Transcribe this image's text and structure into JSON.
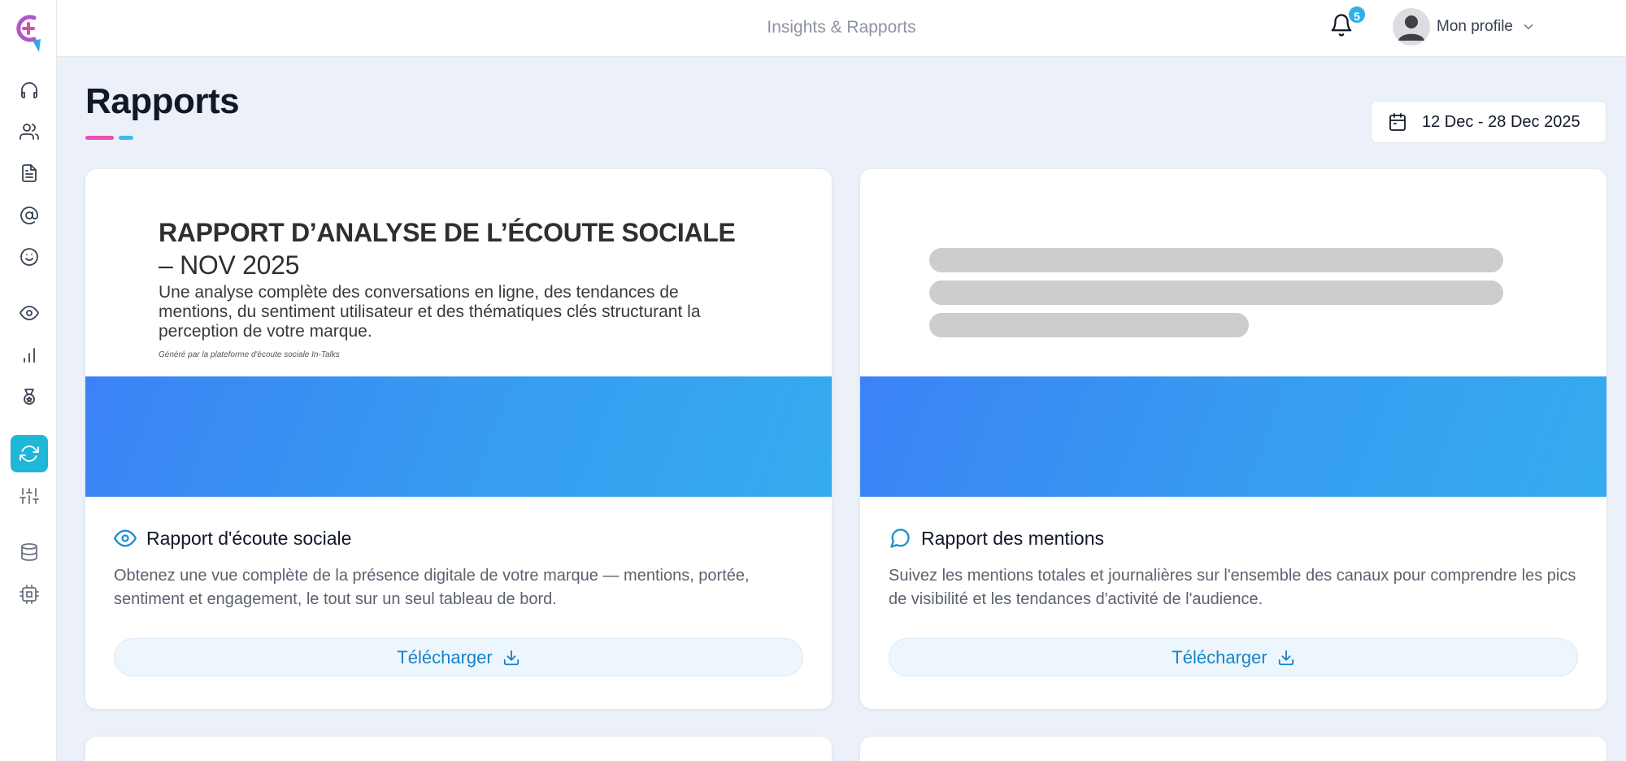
{
  "header": {
    "title": "Insights & Rapports",
    "notifications_count": "5",
    "profile_label": "Mon profile"
  },
  "sidebar": {
    "items": [
      {
        "icon": "headphones-icon"
      },
      {
        "icon": "users-icon"
      },
      {
        "icon": "document-icon"
      },
      {
        "icon": "at-sign-icon"
      },
      {
        "icon": "smile-icon"
      },
      {
        "icon": "eye-icon"
      },
      {
        "icon": "bar-chart-icon"
      },
      {
        "icon": "medal-icon"
      },
      {
        "icon": "refresh-icon",
        "active": true
      },
      {
        "icon": "sliders-icon"
      },
      {
        "icon": "database-icon"
      },
      {
        "icon": "cpu-chip-icon"
      }
    ]
  },
  "page": {
    "title": "Rapports",
    "date_range": "12 Dec - 28 Dec 2025"
  },
  "cards": [
    {
      "preview_title": "RAPPORT D’ANALYSE DE L’ÉCOUTE SOCIALE",
      "preview_title_suffix": "– NOV 2025",
      "preview_subtitle": "Une analyse complète des conversations en ligne, des tendances de mentions, du sentiment utilisateur et des thématiques clés structurant la perception de votre marque.",
      "preview_footer": "Généré par la plateforme d'écoute sociale In-Talks",
      "icon": "eye-icon",
      "title": "Rapport d'écoute sociale",
      "description": "Obtenez une vue complète de la présence digitale de votre marque — mentions, portée, sentiment et engagement, le tout sur un seul tableau de bord.",
      "button_label": "Télécharger"
    },
    {
      "icon": "chat-bubble-icon",
      "title": "Rapport des mentions",
      "description": "Suivez les mentions totales et journalières sur l'ensemble des canaux pour comprendre les pics de visibilité et les tendances d'activité de l'audience.",
      "button_label": "Télécharger"
    }
  ],
  "colors": {
    "accent": "#1fb6d8",
    "link": "#1683c9",
    "underline_pink": "#ec4fb3",
    "underline_blue": "#38bde8",
    "banner_blue": "#3b82f6"
  }
}
